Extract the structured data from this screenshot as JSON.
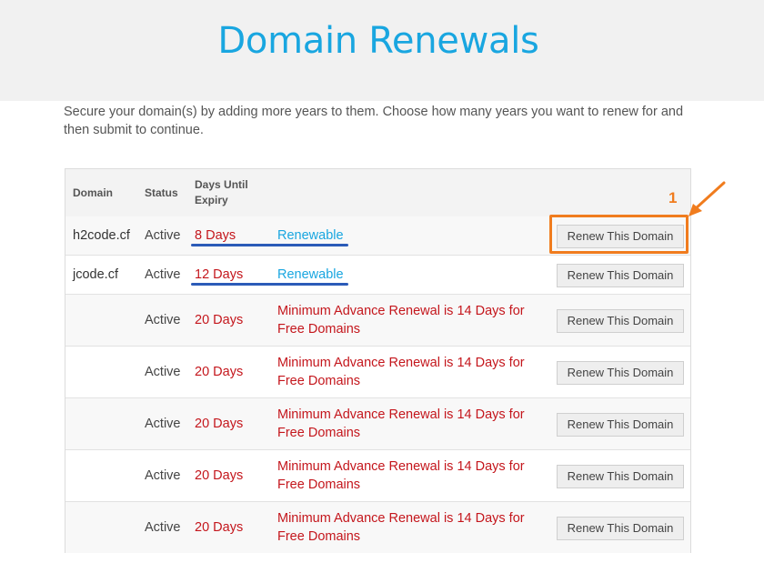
{
  "page": {
    "title": "Domain Renewals",
    "intro": "Secure your domain(s) by adding more years to them. Choose how many years you want to renew for and then submit to continue."
  },
  "table": {
    "headers": {
      "domain": "Domain",
      "status": "Status",
      "days": "Days Until Expiry"
    },
    "rows": [
      {
        "domain": "h2code.cf",
        "status": "Active",
        "days": "8 Days",
        "note": "Renewable",
        "button": "Renew This Domain"
      },
      {
        "domain": "jcode.cf",
        "status": "Active",
        "days": "12 Days",
        "note": "Renewable",
        "button": "Renew This Domain"
      },
      {
        "domain": "",
        "status": "Active",
        "days": "20 Days",
        "note": "Minimum Advance Renewal is 14 Days for Free Domains",
        "button": "Renew This Domain"
      },
      {
        "domain": "",
        "status": "Active",
        "days": "20 Days",
        "note": "Minimum Advance Renewal is 14 Days for Free Domains",
        "button": "Renew This Domain"
      },
      {
        "domain": "",
        "status": "Active",
        "days": "20 Days",
        "note": "Minimum Advance Renewal is 14 Days for Free Domains",
        "button": "Renew This Domain"
      },
      {
        "domain": "",
        "status": "Active",
        "days": "20 Days",
        "note": "Minimum Advance Renewal is 14 Days for Free Domains",
        "button": "Renew This Domain"
      },
      {
        "domain": "",
        "status": "Active",
        "days": "20 Days",
        "note": "Minimum Advance Renewal is 14 Days for Free Domains",
        "button": "Renew This Domain"
      }
    ]
  },
  "annotation": {
    "step_number": "1"
  },
  "colors": {
    "title": "#19a6e0",
    "expiry_red": "#c4161c",
    "renewable_blue": "#19a6e0",
    "highlight_orange": "#f07c1e",
    "underline_blue": "#2b5bb8"
  }
}
